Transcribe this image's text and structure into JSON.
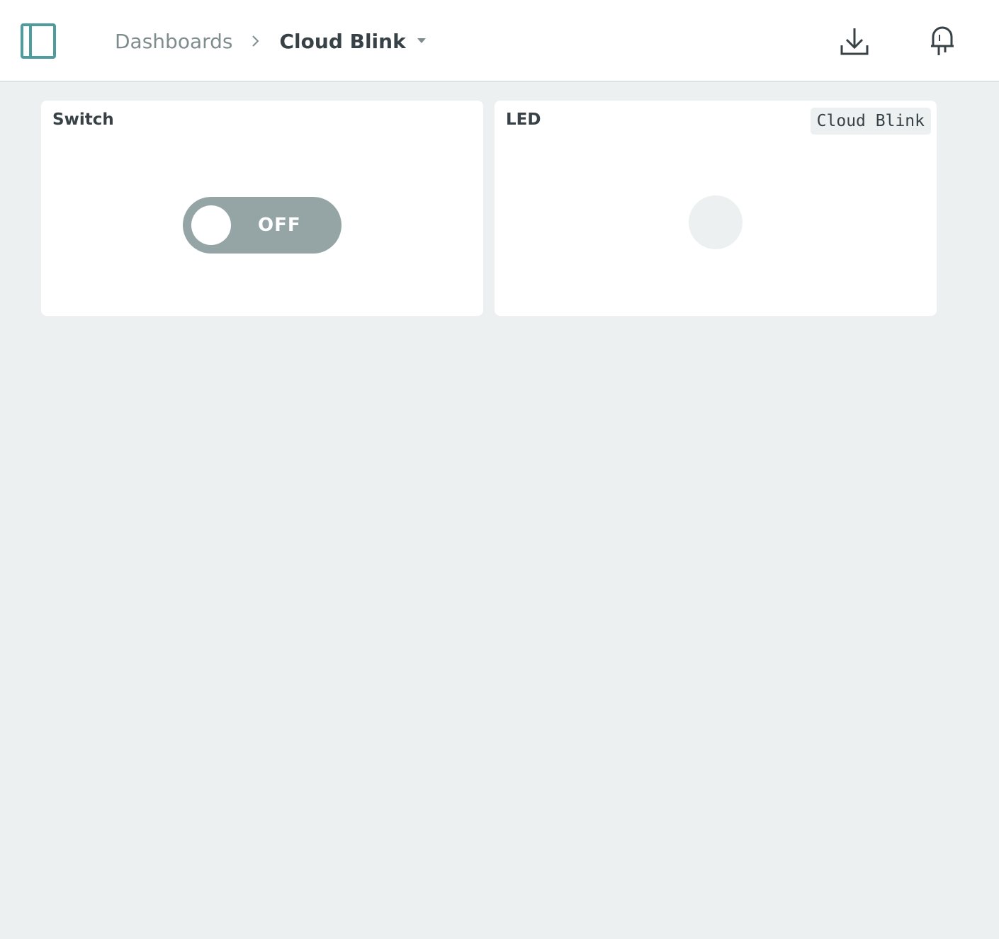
{
  "header": {
    "breadcrumb": {
      "parent": "Dashboards",
      "current": "Cloud Blink"
    },
    "icons": {
      "sidebar_toggle": "sidebar-panel-icon",
      "download": "download-icon",
      "led": "led-icon",
      "separator": "chevron-right-icon",
      "dropdown": "caret-down-icon"
    }
  },
  "widgets": [
    {
      "title": "Switch",
      "type": "switch",
      "state": "OFF"
    },
    {
      "title": "LED",
      "type": "led",
      "device_tag": "Cloud Blink",
      "led_on": false
    }
  ],
  "colors": {
    "accent": "#4E9CA0",
    "background": "#ECF0F1",
    "toggle_off": "#95A5A6",
    "text_dark": "#374146",
    "text_muted": "#7F8C8D"
  }
}
